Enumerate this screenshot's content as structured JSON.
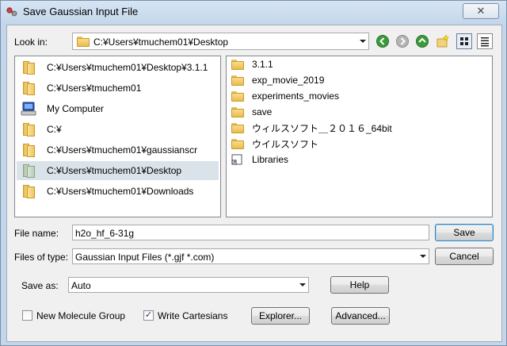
{
  "window": {
    "title": "Save Gaussian Input File",
    "close_glyph": "✕"
  },
  "look_in": {
    "label": "Look in:",
    "value": "C:¥Users¥tmuchem01¥Desktop"
  },
  "toolbar": {
    "icons": [
      "back-icon",
      "forward-icon",
      "up-folder-icon",
      "new-folder-icon",
      "list-view-icon",
      "detail-view-icon"
    ]
  },
  "left_pane": {
    "items": [
      {
        "label": "C:¥Users¥tmuchem01¥Desktop¥3.1.1",
        "icon": "folder-icon"
      },
      {
        "label": "C:¥Users¥tmuchem01",
        "icon": "folder-icon"
      },
      {
        "label": "My Computer",
        "icon": "computer-icon"
      },
      {
        "label": "C:¥",
        "icon": "folder-icon"
      },
      {
        "label": "C:¥Users¥tmuchem01¥gaussianscr",
        "icon": "folder-icon"
      },
      {
        "label": "C:¥Users¥tmuchem01¥Desktop",
        "icon": "folder-icon",
        "selected": true
      },
      {
        "label": "C:¥Users¥tmuchem01¥Downloads",
        "icon": "folder-icon"
      }
    ]
  },
  "right_pane": {
    "items": [
      {
        "label": "3.1.1",
        "icon": "folder-icon"
      },
      {
        "label": "exp_movie_2019",
        "icon": "folder-icon"
      },
      {
        "label": "experiments_movies",
        "icon": "folder-icon"
      },
      {
        "label": "save",
        "icon": "folder-icon"
      },
      {
        "label": "ウィルスソフト＿２０１６_64bit",
        "icon": "folder-icon"
      },
      {
        "label": "ウイルスソフト",
        "icon": "folder-icon"
      },
      {
        "label": "Libraries",
        "icon": "shortcut-icon"
      }
    ]
  },
  "file_name": {
    "label": "File name:",
    "value": "h2o_hf_6-31g"
  },
  "file_type": {
    "label": "Files of type:",
    "value": "Gaussian Input Files (*.gjf *.com)"
  },
  "save_as": {
    "label": "Save as:",
    "value": "Auto"
  },
  "buttons": {
    "save": "Save",
    "cancel": "Cancel",
    "help": "Help",
    "explorer": "Explorer...",
    "advanced": "Advanced..."
  },
  "checkboxes": {
    "new_molecule_group": {
      "label": "New Molecule Group",
      "checked": false
    },
    "write_cartesians": {
      "label": "Write Cartesians",
      "checked": true,
      "check_glyph": "✓"
    }
  }
}
